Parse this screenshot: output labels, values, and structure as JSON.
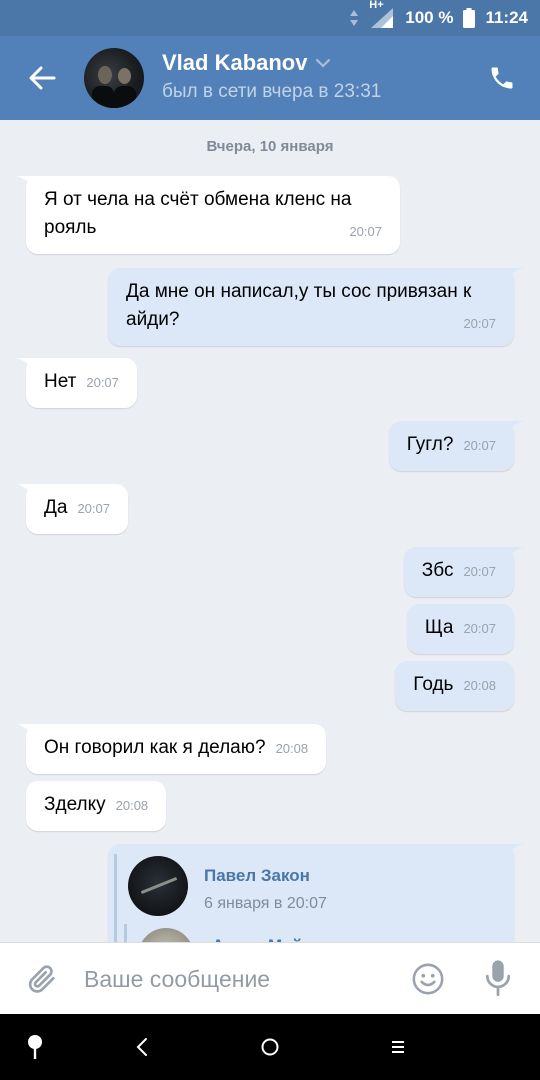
{
  "status_bar": {
    "network": "H+",
    "battery": "100 %",
    "time": "11:24"
  },
  "header": {
    "contact_name": "Vlad Kabanov",
    "last_seen": "был в сети вчера в 23:31",
    "back_icon": "arrow-left-icon",
    "call_icon": "phone-icon",
    "chevron_icon": "chevron-down-icon"
  },
  "chat": {
    "date_separator": "Вчера, 10 января",
    "messages": [
      {
        "dir": "in",
        "text": "Я от чела на счёт обмена кленс на рояль",
        "time": "20:07"
      },
      {
        "dir": "out",
        "text": "Да мне он написал,у ты сос привязан к айди?",
        "time": "20:07"
      },
      {
        "dir": "in",
        "text": "Нет",
        "time": "20:07"
      },
      {
        "dir": "out",
        "text": "Гугл?",
        "time": "20:07"
      },
      {
        "dir": "in",
        "text": "Да",
        "time": "20:07"
      },
      {
        "dir": "out",
        "text": "Збс",
        "time": "20:07"
      },
      {
        "dir": "out",
        "text": "Ща",
        "time": "20:07"
      },
      {
        "dir": "out",
        "text": "Годь",
        "time": "20:08"
      },
      {
        "dir": "in",
        "text": "Он говорил как я делаю?",
        "time": "20:08"
      },
      {
        "dir": "in",
        "text": "Зделку",
        "time": "20:08"
      }
    ],
    "forwarded": {
      "author": "Павел Закон",
      "date": "6 января в 20:07",
      "nested_author": "Антон Майоров"
    }
  },
  "input": {
    "placeholder": "Ваше сообщение",
    "attach_icon": "paperclip-icon",
    "emoji_icon": "smile-icon",
    "mic_icon": "microphone-icon"
  },
  "nav": {
    "items": [
      "pin-icon",
      "back-icon",
      "home-icon",
      "menu-icon"
    ]
  },
  "colors": {
    "header": "#5181b8",
    "status_bar": "#4a76a8",
    "background": "#ebeff4",
    "bubble_in": "#ffffff",
    "bubble_out": "#dce8f7",
    "link": "#4a76a8"
  }
}
